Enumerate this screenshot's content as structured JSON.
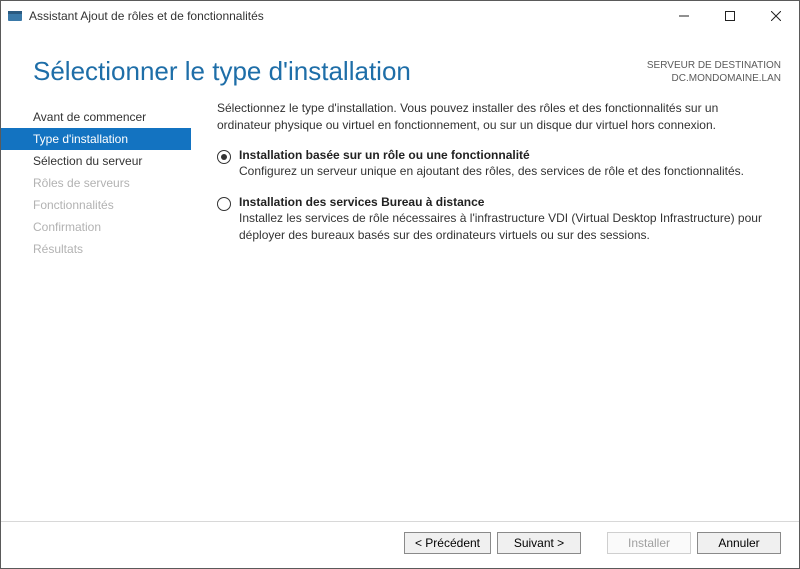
{
  "window": {
    "title": "Assistant Ajout de rôles et de fonctionnalités"
  },
  "header": {
    "page_title": "Sélectionner le type d'installation",
    "dest_label": "SERVEUR DE DESTINATION",
    "dest_value": "DC.MONDOMAINE.LAN"
  },
  "sidebar": {
    "items": [
      {
        "label": "Avant de commencer",
        "state": "done"
      },
      {
        "label": "Type d'installation",
        "state": "selected"
      },
      {
        "label": "Sélection du serveur",
        "state": "enabled"
      },
      {
        "label": "Rôles de serveurs",
        "state": "disabled"
      },
      {
        "label": "Fonctionnalités",
        "state": "disabled"
      },
      {
        "label": "Confirmation",
        "state": "disabled"
      },
      {
        "label": "Résultats",
        "state": "disabled"
      }
    ]
  },
  "content": {
    "intro": "Sélectionnez le type d'installation. Vous pouvez installer des rôles et des fonctionnalités sur un ordinateur physique ou virtuel en fonctionnement, ou sur un disque dur virtuel hors connexion.",
    "options": [
      {
        "selected": true,
        "title": "Installation basée sur un rôle ou une fonctionnalité",
        "desc": "Configurez un serveur unique en ajoutant des rôles, des services de rôle et des fonctionnalités."
      },
      {
        "selected": false,
        "title": "Installation des services Bureau à distance",
        "desc": "Installez les services de rôle nécessaires à l'infrastructure VDI (Virtual Desktop Infrastructure) pour déployer des bureaux basés sur des ordinateurs virtuels ou sur des sessions."
      }
    ]
  },
  "footer": {
    "prev": "< Précédent",
    "next": "Suivant >",
    "install": "Installer",
    "cancel": "Annuler"
  }
}
